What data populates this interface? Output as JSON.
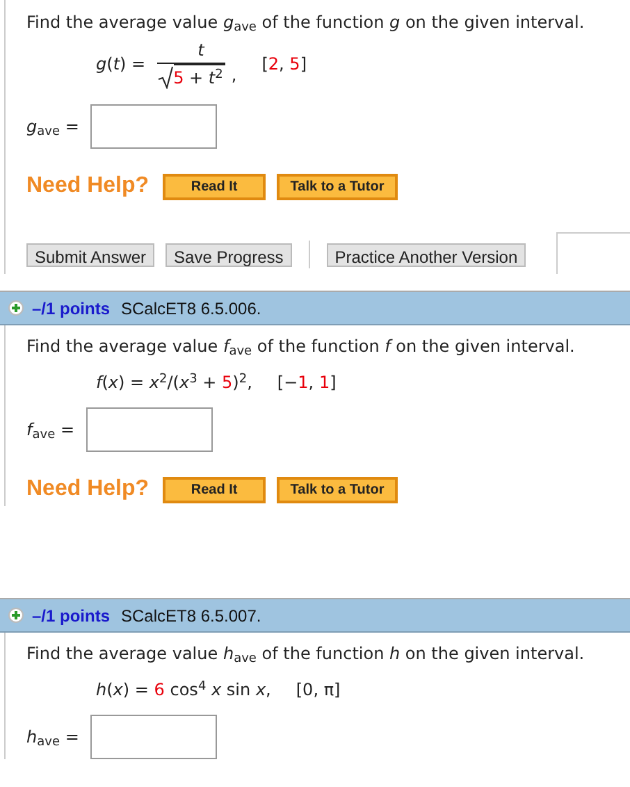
{
  "questions": [
    {
      "prompt": "Find the average value *g*$_{ave}$ of the function *g* on the given interval.",
      "formula": {
        "kind": "fraction",
        "lhs": "*g*(*t*) =",
        "numerator": "*t*",
        "denominator": [
          {
            "text": "5",
            "highlight": true
          },
          {
            "text": " + *t*$^{2}$",
            "highlight": false
          }
        ],
        "trail": ",",
        "interval": [
          {
            "text": "[",
            "highlight": false
          },
          {
            "text": "2",
            "highlight": true
          },
          {
            "text": ", ",
            "highlight": false
          },
          {
            "text": "5",
            "highlight": true
          },
          {
            "text": "]",
            "highlight": false
          }
        ]
      },
      "answer_label": "*g*$_{ave}$ =",
      "help": {
        "label": "Need Help?",
        "buttons": [
          "Read It",
          "Talk to a Tutor"
        ]
      },
      "actions": [
        "Submit Answer",
        "Save Progress",
        "Practice Another Version"
      ]
    },
    {
      "header": {
        "points": "–/1 points",
        "code": "SCalcET8 6.5.006."
      },
      "prompt": "Find the average value *f*$_{ave}$ of the function *f* on the given interval.",
      "formula": {
        "kind": "inline",
        "parts": [
          {
            "text": "*f*(*x*) = *x*$^{2}$/(*x*$^{3}$ + ",
            "highlight": false
          },
          {
            "text": "5",
            "highlight": true
          },
          {
            "text": ")$^{2}$,",
            "highlight": false
          }
        ],
        "interval": [
          {
            "text": "[−",
            "highlight": false
          },
          {
            "text": "1",
            "highlight": true
          },
          {
            "text": ", ",
            "highlight": false
          },
          {
            "text": "1",
            "highlight": true
          },
          {
            "text": "]",
            "highlight": false
          }
        ]
      },
      "answer_label": "*f*$_{ave}$ =",
      "help": {
        "label": "Need Help?",
        "buttons": [
          "Read It",
          "Talk to a Tutor"
        ]
      }
    },
    {
      "header": {
        "points": "–/1 points",
        "code": "SCalcET8 6.5.007."
      },
      "prompt": "Find the average value *h*$_{ave}$ of the function *h* on the given interval.",
      "formula": {
        "kind": "inline",
        "parts": [
          {
            "text": "*h*(*x*) = ",
            "highlight": false
          },
          {
            "text": "6",
            "highlight": true
          },
          {
            "text": " cos$^{4}$ *x* sin *x*,",
            "highlight": false
          }
        ],
        "interval": [
          {
            "text": "[0, π]",
            "highlight": false
          }
        ]
      },
      "answer_label": "*h*$_{ave}$ ="
    }
  ]
}
